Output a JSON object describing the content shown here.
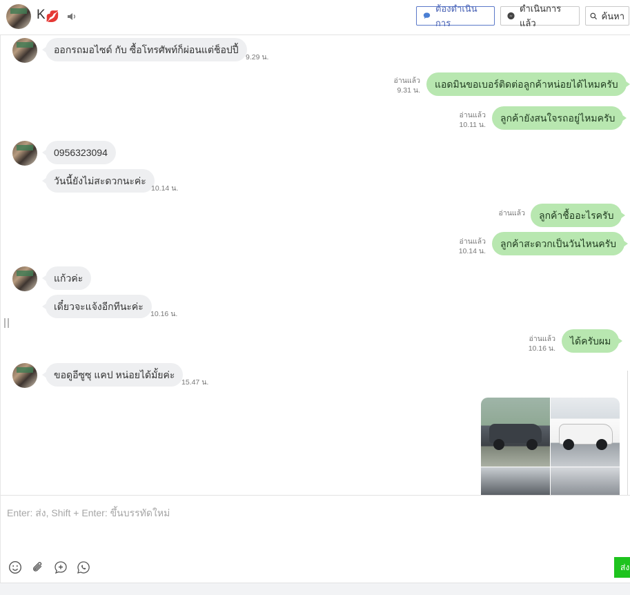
{
  "header": {
    "contact_name": "K",
    "todo_label": "ต้องดำเนินการ",
    "done_label": "ดำเนินการแล้ว",
    "search_label": "ค้นหา",
    "accent_color": "#4a63b5"
  },
  "messages": {
    "m1": {
      "text": "ออกรถมอไซด์ กับ ซื้อโทรศัพท์ก็ผ่อนแต่ช็อปปี้",
      "time": "9.29 น."
    },
    "m2": {
      "text": "แอดมินขอเบอร์ติดต่อลูกค้าหน่อยได้ไหมครับ",
      "read": "อ่านแล้ว",
      "time": "9.31 น."
    },
    "m3": {
      "text": "ลูกค้ายังสนใจรถอยู่ไหมครับ",
      "read": "อ่านแล้ว",
      "time": "10.11 น."
    },
    "m4": {
      "text": "0956323094"
    },
    "m5": {
      "text": "วันนี้ยังไม่สะดวกนะค่ะ",
      "time": "10.14 น."
    },
    "m6": {
      "text": "ลูกค้าชื้ออะไรครับ",
      "read": "อ่านแล้ว"
    },
    "m7": {
      "text": "ลูกค้าสะดวกเป็นวันไหนครับ",
      "read": "อ่านแล้ว",
      "time": "10.14 น."
    },
    "m8": {
      "text": "แก้วค่ะ"
    },
    "m9": {
      "text": "เดี๋ยวจะแจ้งอีกทีนะค่ะ",
      "time": "10.16 น."
    },
    "m10": {
      "text": "ได้ครับผม",
      "read": "อ่านแล้ว",
      "time": "10.16 น."
    },
    "m11": {
      "text": "ขอดูอีซูซุ แคป หน่อยได้มั้ยค่ะ",
      "time": "15.47 น."
    }
  },
  "composer": {
    "placeholder": "Enter: ส่ง, Shift + Enter: ขึ้นบรรทัดใหม่",
    "send_label": "ส่ง",
    "icons": [
      "emoji-icon",
      "attachment-icon",
      "add-comment-icon",
      "line-chat-icon"
    ]
  }
}
